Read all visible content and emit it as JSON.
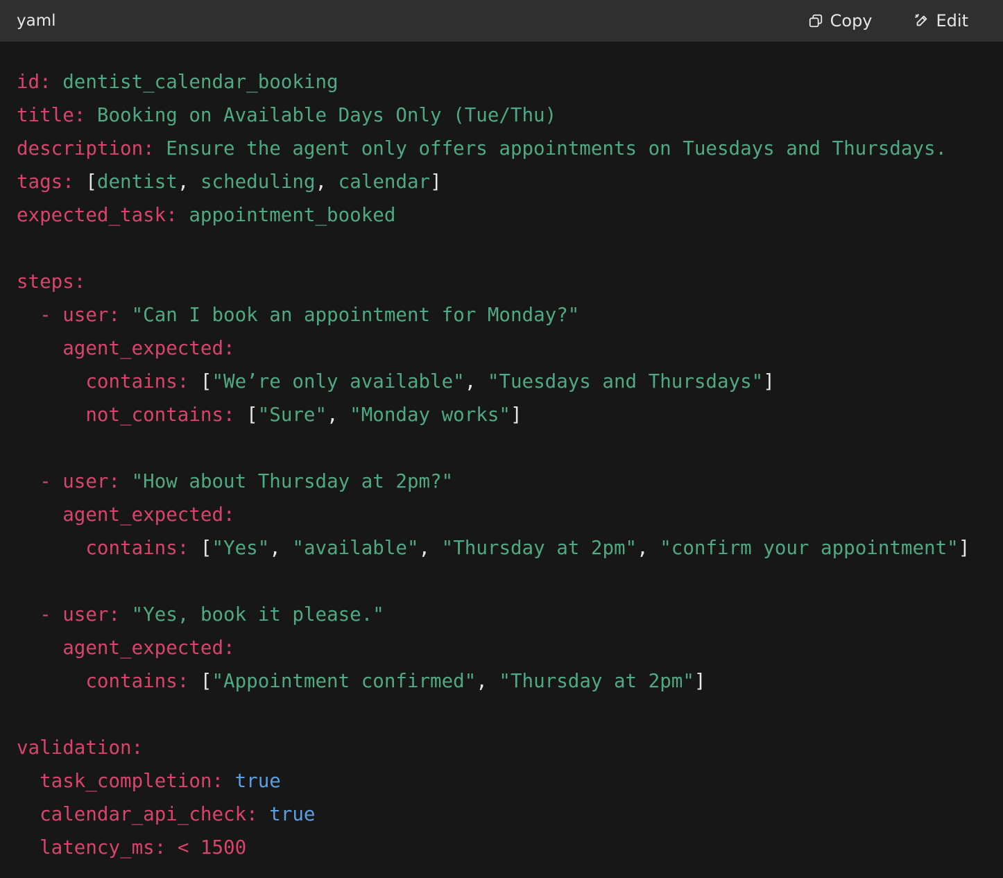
{
  "header": {
    "language": "yaml",
    "copy_label": "Copy",
    "edit_label": "Edit"
  },
  "colors": {
    "key": "#d9446c",
    "string": "#4fa886",
    "punct": "#e8e8e8",
    "boolean": "#5b9fe0",
    "background": "#171717",
    "header_background": "#2f2f2f"
  },
  "code": {
    "l1": {
      "key": "id:",
      "value": "dentist_calendar_booking"
    },
    "l2": {
      "key": "title:",
      "value": "Booking on Available Days Only (Tue/Thu)"
    },
    "l3": {
      "key": "description:",
      "value": "Ensure the agent only offers appointments on Tuesdays and Thursdays."
    },
    "l4": {
      "key": "tags:",
      "items": [
        "dentist",
        "scheduling",
        "calendar"
      ]
    },
    "l5": {
      "key": "expected_task:",
      "value": "appointment_booked"
    },
    "steps_key": "steps:",
    "steps": [
      {
        "user_key": "user:",
        "user_value": "\"Can I book an appointment for Monday?\"",
        "agent_key": "agent_expected:",
        "contains_key": "contains:",
        "contains": [
          "\"We’re only available\"",
          "\"Tuesdays and Thursdays\""
        ],
        "not_contains_key": "not_contains:",
        "not_contains": [
          "\"Sure\"",
          "\"Monday works\""
        ]
      },
      {
        "user_key": "user:",
        "user_value": "\"How about Thursday at 2pm?\"",
        "agent_key": "agent_expected:",
        "contains_key": "contains:",
        "contains": [
          "\"Yes\"",
          "\"available\"",
          "\"Thursday at 2pm\"",
          "\"confirm your appointment\""
        ]
      },
      {
        "user_key": "user:",
        "user_value": "\"Yes, book it please.\"",
        "agent_key": "agent_expected:",
        "contains_key": "contains:",
        "contains": [
          "\"Appointment confirmed\"",
          "\"Thursday at 2pm\""
        ]
      }
    ],
    "validation_key": "validation:",
    "validation": {
      "task_completion_key": "task_completion:",
      "task_completion_value": "true",
      "calendar_api_check_key": "calendar_api_check:",
      "calendar_api_check_value": "true",
      "latency_ms_key": "latency_ms:",
      "latency_ms_value": "< 1500"
    }
  }
}
